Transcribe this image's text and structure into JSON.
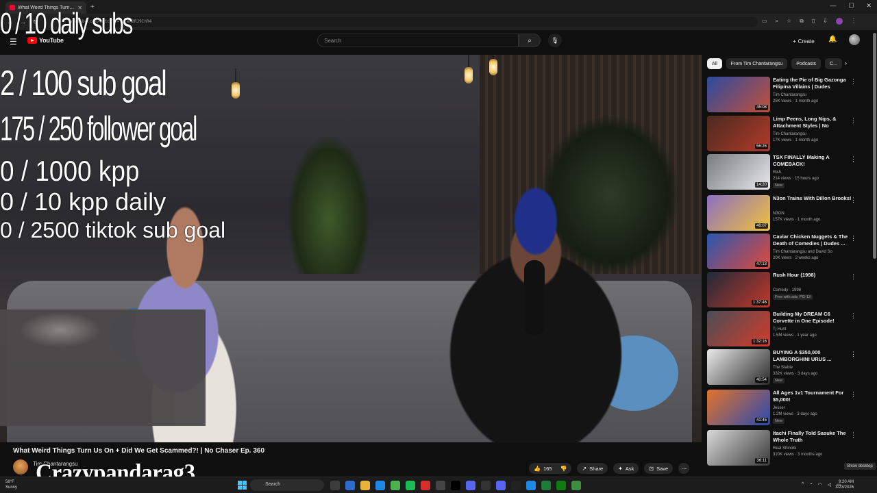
{
  "browser": {
    "tab_title": "What Weird Things Turn U...",
    "url": "youtube.com/watch?v=...eh2RJ91hR4"
  },
  "header": {
    "logo_text": "YouTube",
    "search_placeholder": "Search",
    "create_label": "Create"
  },
  "overlay": {
    "daily_subs": "0 / 10 daily subs",
    "sub_goal": "2  / 100 sub goal",
    "follower_goal": "175 / 250 follower goal",
    "kpp": "0 / 1000 kpp",
    "kpp_daily": "0 / 10 kpp daily",
    "tiktok_goal": "0 / 2500 tiktok sub goal",
    "username": "Crazypandarag3"
  },
  "video": {
    "title": "What Weird Things Turn Us On + Did We Get Scammed?! | No Chaser Ep. 360",
    "channel": "Tim Chantarangsu",
    "likes": "165",
    "share_label": "Share",
    "ask_label": "Ask",
    "save_label": "Save"
  },
  "chips": [
    "All",
    "From Tim Chantarangsu",
    "Podcasts",
    "C..."
  ],
  "recommendations": [
    {
      "title": "Eating the Pie of Big Gazonga Filipina Villains | Dudes Behind...",
      "channel": "Tim Chantarangsu",
      "meta": "25K views · 1 month ago",
      "duration": "45:08",
      "badge": "",
      "badge2": "",
      "colors": [
        "#2b4aa0",
        "#c2503a"
      ]
    },
    {
      "title": "Limp Peens, Long Nips, & Attachment Styles | No Chaser...",
      "channel": "Tim Chantarangsu",
      "meta": "17K views · 1 month ago",
      "duration": "56:26",
      "badge": "",
      "badge2": "",
      "colors": [
        "#4a2a20",
        "#b33a2a"
      ]
    },
    {
      "title": "TSX FINALLY Making A COMEBACK!",
      "channel": "Rish",
      "meta": "214 views · 15 hours ago",
      "duration": "14:20",
      "badge": "New",
      "badge2": "",
      "colors": [
        "#777a80",
        "#e9eaec"
      ]
    },
    {
      "title": "N3on Trains With Dillon Brooks!",
      "channel": "N3ON",
      "meta": "157K views · 1 month ago",
      "duration": "46:07",
      "badge": "",
      "badge2": "",
      "colors": [
        "#8d6fc2",
        "#f0c23a"
      ]
    },
    {
      "title": "Caviar Chicken Nuggets & The Death of Comedies | Dudes ...",
      "channel": "Tim Chantarangsu and David So",
      "meta": "20K views · 2 weeks ago",
      "duration": "47:13",
      "badge": "",
      "badge2": "",
      "colors": [
        "#2a56b0",
        "#e04a3a"
      ]
    },
    {
      "title": "Rush Hour (1998)",
      "channel": "Comedy · 1998",
      "meta": "",
      "duration": "1:37:46",
      "badge": "Free with ads",
      "badge2": "PG-13",
      "colors": [
        "#1f2a3a",
        "#c2372a"
      ]
    },
    {
      "title": "Building My DREAM C6 Corvette in One Episode!",
      "channel": "Tj Hunt",
      "meta": "1.5M views · 1 year ago",
      "duration": "1:32:16",
      "badge": "",
      "badge2": "",
      "colors": [
        "#4a4e56",
        "#d43a2a"
      ]
    },
    {
      "title": "BUYING A $350,000 LAMBORGHINI URUS ...",
      "channel": "The Stable",
      "meta": "332K views · 3 days ago",
      "duration": "40:54",
      "badge": "New",
      "badge2": "",
      "colors": [
        "#eaeaea",
        "#2a2a2a"
      ]
    },
    {
      "title": "All Ages 1v1 Tournament For $5,000!",
      "channel": "Jesser",
      "meta": "1.2M views · 3 days ago",
      "duration": "41:45",
      "badge": "New",
      "badge2": "",
      "colors": [
        "#e2732a",
        "#2a4ab0"
      ]
    },
    {
      "title": "Itachi Finally Told Sasuke The Whole Truth",
      "channel": "Real Shinobi",
      "meta": "310K views · 3 months ago",
      "duration": "36:11",
      "badge": "",
      "badge2": "",
      "colors": [
        "#d9d9d9",
        "#3a3a3a"
      ]
    }
  ],
  "taskbar": {
    "temp": "58°F",
    "weather": "Sunny",
    "search_label": "Search",
    "time": "9:20 AM",
    "date": "3/23/2026",
    "show_desktop": "Show desktop"
  }
}
